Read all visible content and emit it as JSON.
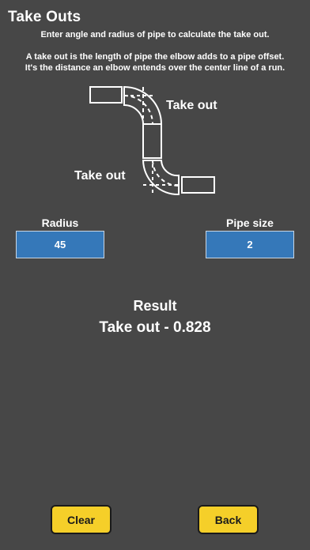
{
  "header": {
    "title": "Take Outs",
    "subtitle": "Enter angle and radius of pipe to calculate the take out."
  },
  "description": {
    "line1": "A take out is the length of pipe the elbow adds to a pipe offset.",
    "line2": "It's the distance an elbow entends over the center line of a run."
  },
  "diagram": {
    "label_top": "Take out",
    "label_bottom": "Take out"
  },
  "inputs": {
    "radius_label": "Radius",
    "radius_value": "45",
    "pipe_size_label": "Pipe size",
    "pipe_size_value": "2"
  },
  "result": {
    "title": "Result",
    "value": "Take out - 0.828"
  },
  "buttons": {
    "clear_label": "Clear",
    "back_label": "Back"
  },
  "colors": {
    "background": "#474747",
    "input_fill": "#3578b9",
    "button_fill": "#f5cf29"
  }
}
